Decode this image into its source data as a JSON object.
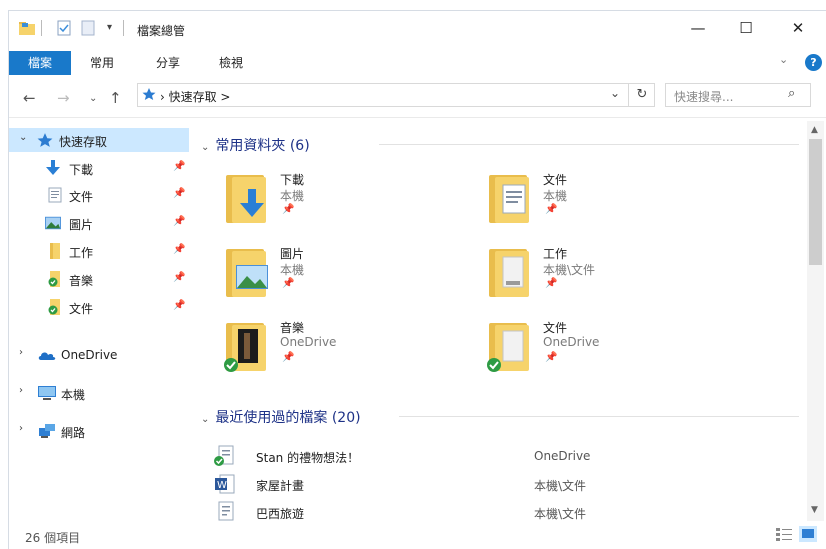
{
  "window": {
    "title": "檔案總管",
    "controls": {
      "minimize": "—",
      "maximize": "☐",
      "close": "✕"
    }
  },
  "ribbon": {
    "tabs": [
      "檔案",
      "常用",
      "分享",
      "檢視"
    ],
    "help": "?"
  },
  "address": {
    "crumbs": "› 快速存取 >",
    "search_placeholder": "快速搜尋..."
  },
  "nav": {
    "quick_access": "快速存取",
    "pinned": [
      {
        "label": "下載",
        "icon": "download-icon"
      },
      {
        "label": "文件",
        "icon": "document-icon"
      },
      {
        "label": "圖片",
        "icon": "picture-icon"
      },
      {
        "label": "工作",
        "icon": "folder-icon"
      },
      {
        "label": "音樂",
        "icon": "music-folder-icon"
      },
      {
        "label": "文件",
        "icon": "onedrive-folder-icon"
      }
    ],
    "onedrive": "OneDrive",
    "this_pc": "本機",
    "network": "網路"
  },
  "frequent": {
    "header": "常用資料夾 (6)",
    "folders": [
      {
        "name": "下載",
        "location": "本機"
      },
      {
        "name": "文件",
        "location": "本機"
      },
      {
        "name": "圖片",
        "location": "本機"
      },
      {
        "name": "工作",
        "location": "本機\\文件"
      },
      {
        "name": "音樂",
        "location": "OneDrive"
      },
      {
        "name": "文件",
        "location": "OneDrive"
      }
    ]
  },
  "recent": {
    "header": "最近使用過的檔案 (20)",
    "files": [
      {
        "name": "Stan 的禮物想法！",
        "location": "OneDrive"
      },
      {
        "name": "家屋計畫",
        "location": "本機\\文件"
      },
      {
        "name": "巴西旅遊",
        "location": "本機\\文件"
      }
    ]
  },
  "status": {
    "item_count": "26 個項目"
  },
  "colors": {
    "accent": "#1979ca",
    "selection": "#cce8ff",
    "group_header": "#1e3287",
    "folder": "#f6d36b"
  }
}
